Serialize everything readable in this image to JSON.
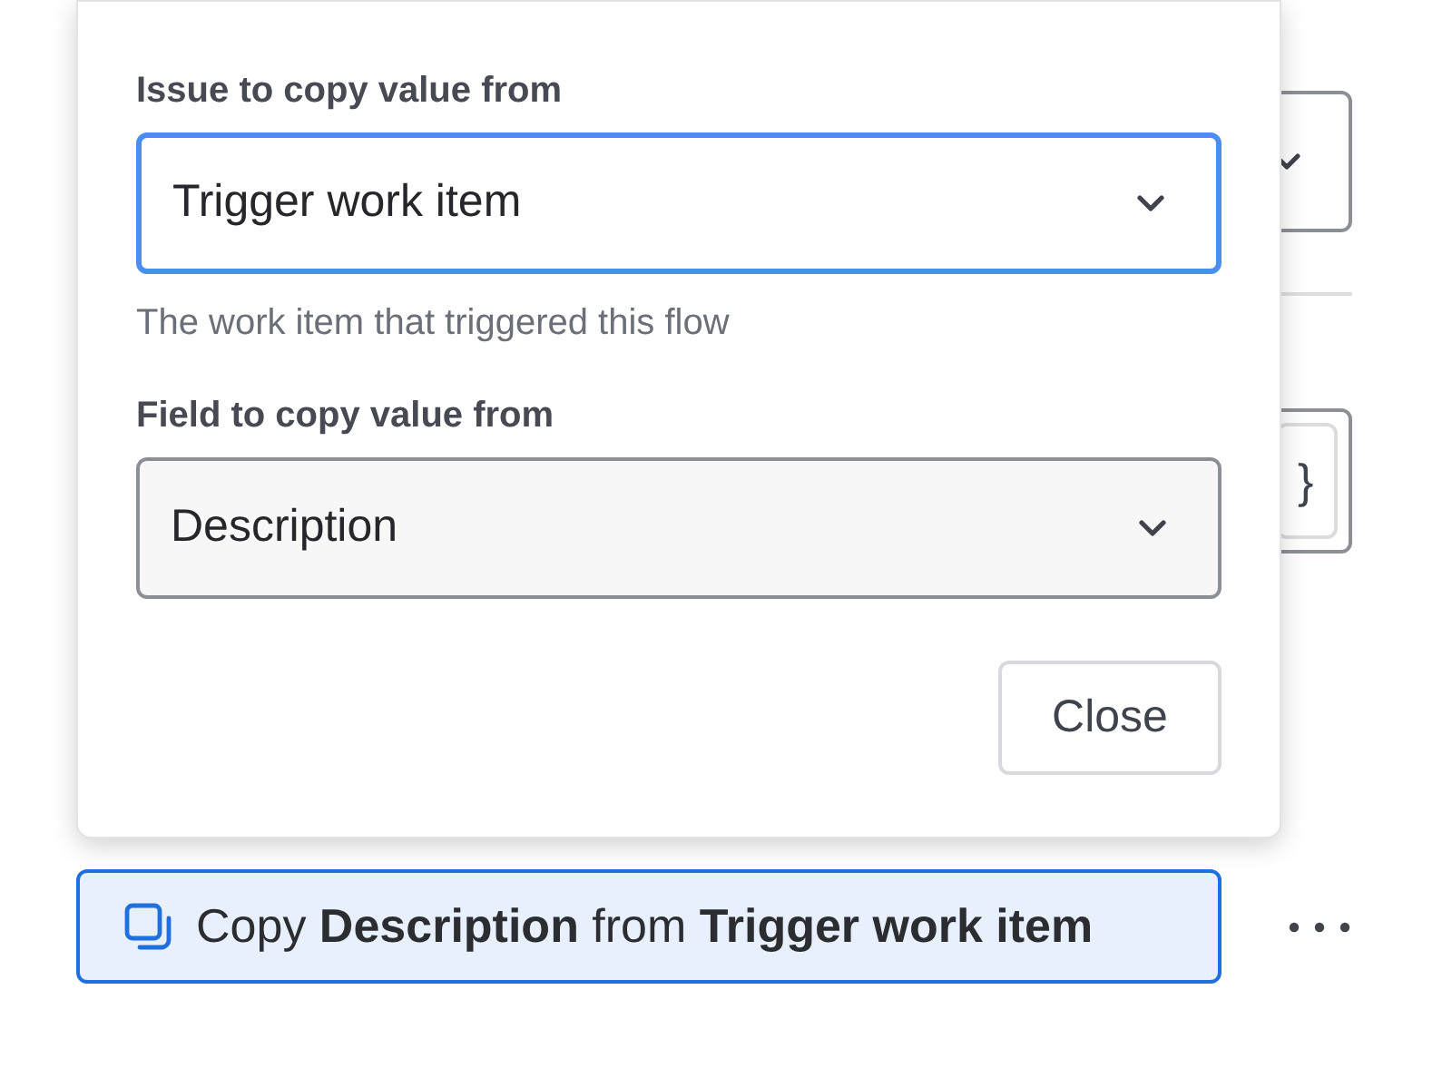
{
  "background": {
    "brace_button": "}"
  },
  "popover": {
    "fields": [
      {
        "label": "Issue to copy value from",
        "value": "Trigger work item",
        "focused": true,
        "help": "The work item that triggered this flow"
      },
      {
        "label": "Field to copy value from",
        "value": "Description",
        "focused": false
      }
    ],
    "close_button": "Close"
  },
  "copy_action": {
    "text": "Copy **Description** from **Trigger work item**",
    "selected": true
  }
}
